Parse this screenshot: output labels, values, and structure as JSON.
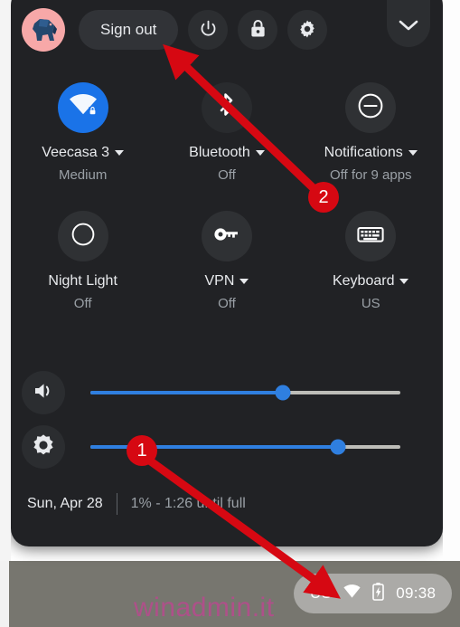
{
  "window": {
    "kind": "chromeos-quick-settings-panel",
    "colors": {
      "panel_bg": "#212225",
      "accent_blue": "#1a73e8",
      "slider_blue": "#2f7fe0",
      "annotation_red": "#d60812",
      "avatar_pink": "#f7a8a8",
      "text_primary": "#e8eaed",
      "text_secondary": "#9aa0a6",
      "shelf_gray": "#77766f"
    }
  },
  "header": {
    "avatar_icon": "elephant-avatar-icon",
    "sign_out_label": "Sign out",
    "buttons": [
      {
        "name": "power-button",
        "icon": "power-icon"
      },
      {
        "name": "lock-button",
        "icon": "lock-icon"
      },
      {
        "name": "settings-button",
        "icon": "gear-icon"
      }
    ],
    "collapse_icon": "chevron-down-icon"
  },
  "tiles": [
    {
      "name": "network",
      "icon": "wifi-locked-icon",
      "label": "Veecasa 3",
      "sublabel": "Medium",
      "has_caret": true,
      "state": "on"
    },
    {
      "name": "bluetooth",
      "icon": "bluetooth-icon",
      "label": "Bluetooth",
      "sublabel": "Off",
      "has_caret": true,
      "state": "off"
    },
    {
      "name": "notifications",
      "icon": "do-not-disturb-icon",
      "label": "Notifications",
      "sublabel": "Off for 9 apps",
      "has_caret": true,
      "state": "off"
    },
    {
      "name": "night-light",
      "icon": "moon-icon",
      "label": "Night Light",
      "sublabel": "Off",
      "has_caret": false,
      "state": "off"
    },
    {
      "name": "vpn",
      "icon": "key-icon",
      "label": "VPN",
      "sublabel": "Off",
      "has_caret": true,
      "state": "off"
    },
    {
      "name": "keyboard",
      "icon": "keyboard-icon",
      "label": "Keyboard",
      "sublabel": "US",
      "has_caret": true,
      "state": "off"
    }
  ],
  "sliders": {
    "volume": {
      "icon": "volume-up-icon",
      "value_percent": 62
    },
    "brightness": {
      "icon": "brightness-icon",
      "value_percent": 80
    }
  },
  "footer": {
    "date": "Sun, Apr 28",
    "battery": "1% - 1:26 until full"
  },
  "status_tray": {
    "input_method": "US",
    "wifi_icon": "wifi-icon",
    "battery_icon": "battery-charging-icon",
    "clock": "09:38"
  },
  "annotations": [
    {
      "number": "1",
      "points_to": "status-tray"
    },
    {
      "number": "2",
      "points_to": "sign-out-button"
    }
  ],
  "watermark": {
    "text": "winadmin.it"
  }
}
